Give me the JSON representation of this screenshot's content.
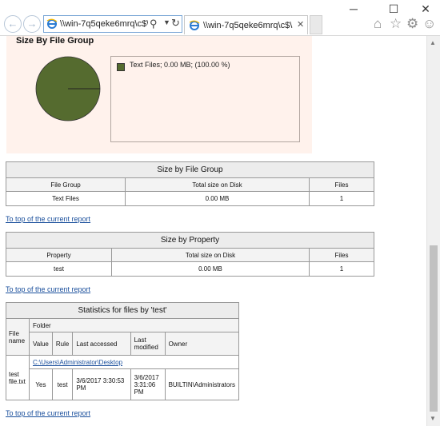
{
  "browser": {
    "address_text": "\\\\win-7q5qeke6mrq\\c$\\St",
    "tab_title": "\\\\win-7q5qeke6mrq\\c$\\Sto...",
    "minimize": "─",
    "maximize": "☐",
    "close": "✕",
    "back_icon": "back-arrow-icon",
    "forward_icon": "forward-arrow-icon",
    "home_icon": "⌂",
    "favorites_icon": "☆",
    "settings_icon": "⚙",
    "smiley_icon": "☺"
  },
  "chart_data": {
    "type": "pie",
    "title": "Size By File Group",
    "categories": [
      "Text Files"
    ],
    "values": [
      100
    ],
    "legend": [
      "Text Files; 0.00 MB; (100.00 %)"
    ],
    "colors": [
      "#556b2f"
    ],
    "legend_position": "right"
  },
  "chart_legend": {
    "entry": "Text Files; 0.00 MB; (100.00 %)"
  },
  "file_group_table": {
    "caption": "Size by File Group",
    "headers": [
      "File Group",
      "Total size on Disk",
      "Files"
    ],
    "rows": [
      [
        "Text Files",
        "0.00 MB",
        "1"
      ]
    ]
  },
  "property_table": {
    "caption": "Size by Property",
    "headers": [
      "Property",
      "Total size on Disk",
      "Files"
    ],
    "rows": [
      [
        "test",
        "0.00 MB",
        "1"
      ]
    ]
  },
  "stats_table": {
    "caption": "Statistics for files by 'test'",
    "file_name_header": "File name",
    "folder_header": "Folder",
    "sub_headers": [
      "Value",
      "Rule",
      "Last accessed",
      "Last modified",
      "Owner"
    ],
    "file_name": "test file.txt",
    "folder_link": "C:\\Users\\Administrator\\Desktop",
    "row": [
      "Yes",
      "test",
      "3/6/2017 3:30:53 PM",
      "3/6/2017 3:31:06 PM",
      "BUILTIN\\Administrators"
    ]
  },
  "links": {
    "to_top_1": "To top of the current report",
    "to_top_2": "To top of the current report",
    "to_top_3": "To top of the current report"
  }
}
